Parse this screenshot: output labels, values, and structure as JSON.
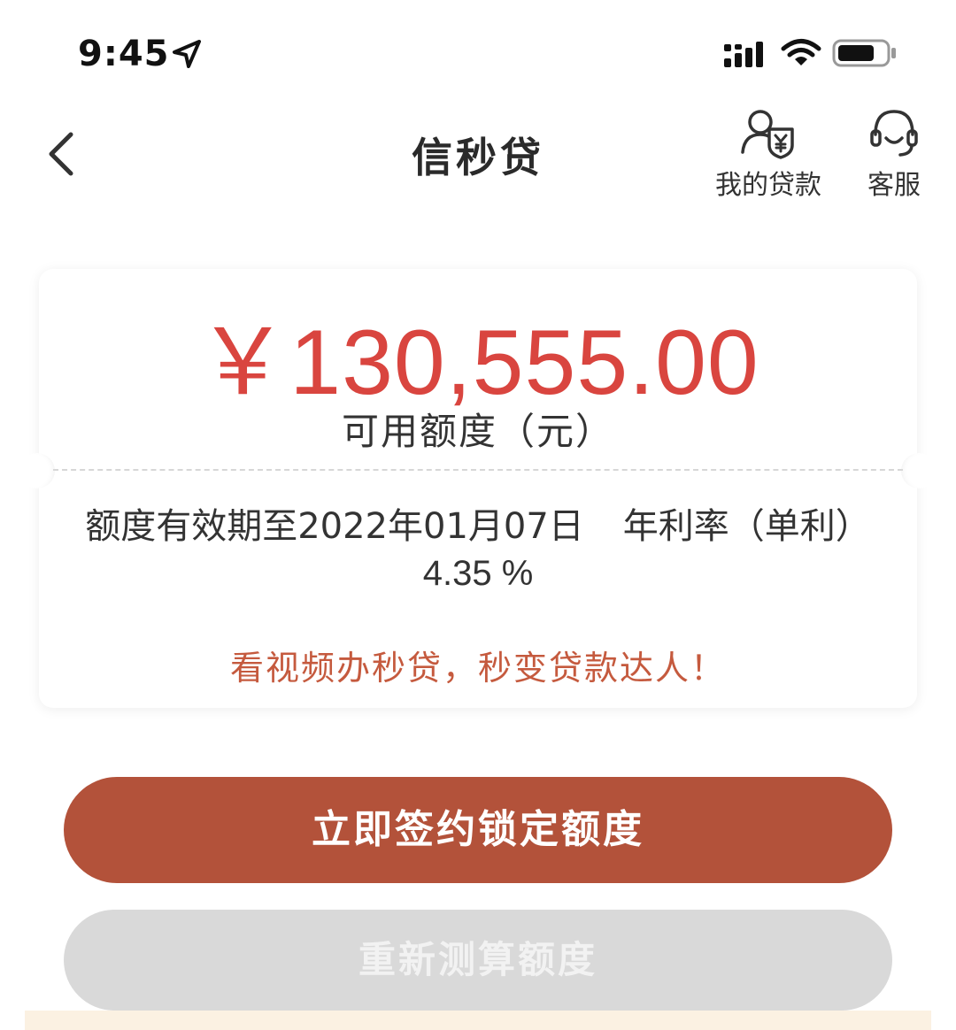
{
  "status_bar": {
    "time": "9:45",
    "icons": [
      "location-arrow-icon",
      "cellular-signal-icon",
      "wifi-icon",
      "battery-icon"
    ]
  },
  "nav": {
    "back_icon": "chevron-left-icon",
    "title": "信秒贷",
    "actions": [
      {
        "label": "我的贷款",
        "icon": "loan-yuan-person-icon"
      },
      {
        "label": "客服",
        "icon": "headset-icon"
      }
    ]
  },
  "quota_card": {
    "amount": "￥130,555.00",
    "amount_label": "可用额度（元）",
    "validity": "额度有效期至2022年01月07日",
    "rate_label": "年利率（单利）",
    "rate_value": "4.35 %",
    "promo": "看视频办秒贷，秒变贷款达人！"
  },
  "buttons": {
    "primary": "立即签约锁定额度",
    "secondary": "重新测算额度"
  },
  "colors": {
    "amount": "#d9453f",
    "primary_button": "#b3523a",
    "secondary_button": "#d9d9d9",
    "promo_text": "#c55a3e"
  }
}
